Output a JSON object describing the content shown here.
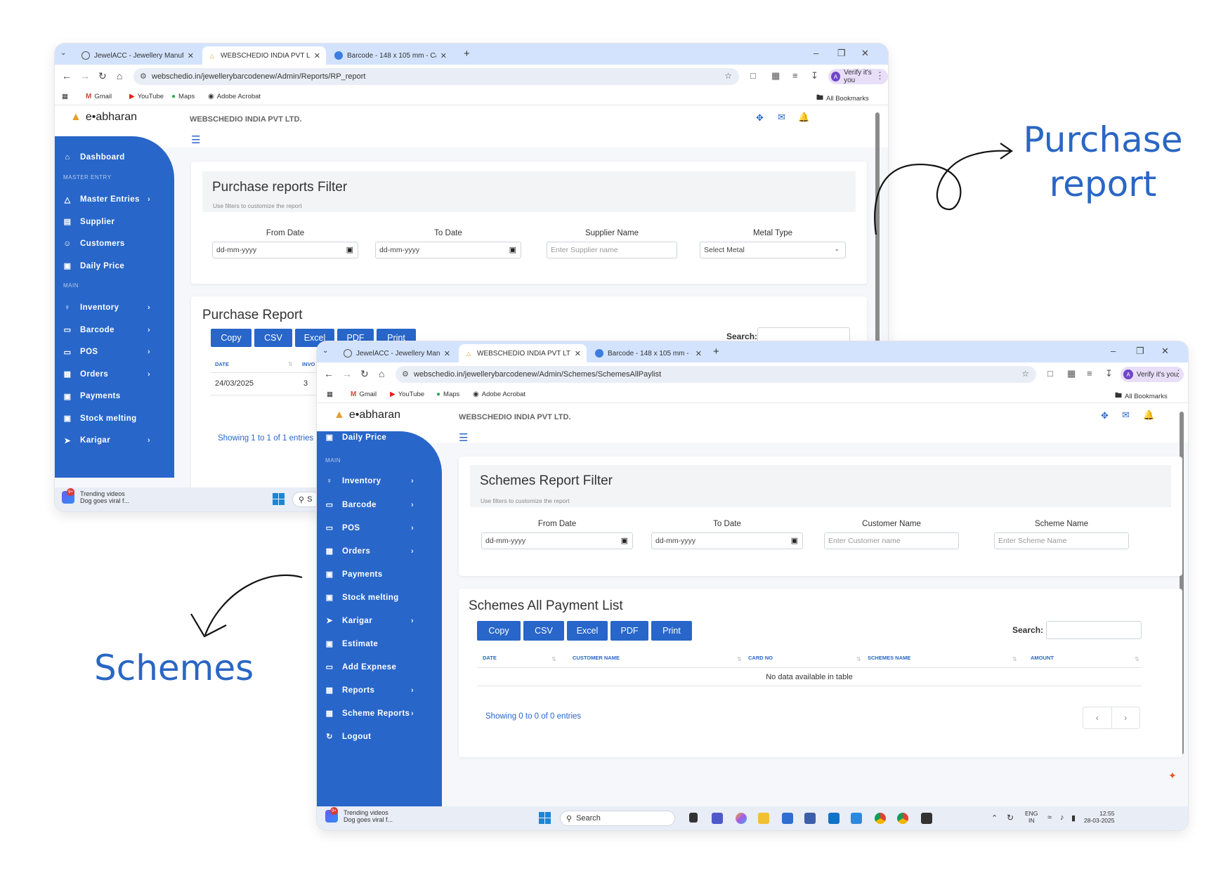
{
  "browser": {
    "tabs": [
      "JewelACC - Jewellery Manufactu...",
      "WEBSCHEDIO INDIA PVT LTD.",
      "Barcode - 148 x 105 mm - Canv..."
    ],
    "verify_label": "Verify it's you",
    "bookmarks": [
      "Gmail",
      "YouTube",
      "Maps",
      "Adobe Acrobat"
    ],
    "all_bookmarks": "All Bookmarks"
  },
  "colors": {
    "primary": "#2866c9",
    "tabbar": "#d3e3fd",
    "annotation": "#2a66c4"
  },
  "app": {
    "logo": "e•abharan",
    "company": "WEBSCHEDIO INDIA PVT LTD."
  },
  "purchase": {
    "url": "webschedio.in/jewellerybarcodenew/Admin/Reports/RP_report",
    "sidebar": {
      "items": [
        {
          "label": "Dashboard",
          "icon": "home-icon"
        },
        {
          "section": "MASTER ENTRY"
        },
        {
          "label": "Master Entries",
          "icon": "compass-icon",
          "chevron": true
        },
        {
          "label": "Supplier",
          "icon": "id-card-icon"
        },
        {
          "label": "Customers",
          "icon": "smile-icon"
        },
        {
          "label": "Daily Price",
          "icon": "money-icon"
        },
        {
          "section": "MAIN"
        },
        {
          "label": "Inventory",
          "icon": "bulb-icon",
          "chevron": true
        },
        {
          "label": "Barcode",
          "icon": "barcode-icon",
          "chevron": true
        },
        {
          "label": "POS",
          "icon": "monitor-icon",
          "chevron": true
        },
        {
          "label": "Orders",
          "icon": "box-icon",
          "chevron": true
        },
        {
          "label": "Payments",
          "icon": "money-icon"
        },
        {
          "label": "Stock melting",
          "icon": "money-icon"
        },
        {
          "label": "Karigar",
          "icon": "hammer-icon",
          "chevron": true
        }
      ]
    },
    "filter": {
      "title": "Purchase reports Filter",
      "subtitle": "Use filters to customize the report",
      "from_label": "From Date",
      "from_value": "dd-mm-yyyy",
      "to_label": "To Date",
      "to_value": "dd-mm-yyyy",
      "supplier_label": "Supplier Name",
      "supplier_placeholder": "Enter Supplier name",
      "metal_label": "Metal Type",
      "metal_value": "Select Metal"
    },
    "list": {
      "title": "Purchase Report",
      "buttons": [
        "Copy",
        "CSV",
        "Excel",
        "PDF",
        "Print"
      ],
      "search_label": "Search:",
      "columns": [
        "DATE",
        "INVO"
      ],
      "rows": [
        [
          "24/03/2025",
          "3"
        ]
      ],
      "info": "Showing 1 to 1 of 1 entries"
    },
    "taskbar": {
      "trending_title": "Trending videos",
      "trending_sub": "Dog goes viral f...",
      "badge": "9+",
      "search": "S"
    }
  },
  "schemes": {
    "url": "webschedio.in/jewellerybarcodenew/Admin/Schemes/SchemesAllPaylist",
    "sidebar": {
      "items": [
        {
          "label": "Daily Price",
          "icon": "money-icon"
        },
        {
          "section": "MAIN"
        },
        {
          "label": "Inventory",
          "icon": "bulb-icon",
          "chevron": true
        },
        {
          "label": "Barcode",
          "icon": "barcode-icon",
          "chevron": true
        },
        {
          "label": "POS",
          "icon": "monitor-icon",
          "chevron": true
        },
        {
          "label": "Orders",
          "icon": "box-icon",
          "chevron": true
        },
        {
          "label": "Payments",
          "icon": "money-icon"
        },
        {
          "label": "Stock melting",
          "icon": "money-icon"
        },
        {
          "label": "Karigar",
          "icon": "hammer-icon",
          "chevron": true
        },
        {
          "label": "Estimate",
          "icon": "money-icon"
        },
        {
          "label": "Add Expnese",
          "icon": "barcode-icon"
        },
        {
          "label": "Reports",
          "icon": "box-icon",
          "chevron": true
        },
        {
          "label": "Scheme Reports",
          "icon": "box-icon",
          "chevron": true
        },
        {
          "label": "Logout",
          "icon": "logout-icon"
        }
      ]
    },
    "filter": {
      "title": "Schemes Report Filter",
      "subtitle": "Use filters to customize the report",
      "from_label": "From Date",
      "from_value": "dd-mm-yyyy",
      "to_label": "To Date",
      "to_value": "dd-mm-yyyy",
      "customer_label": "Customer Name",
      "customer_placeholder": "Enter Customer name",
      "scheme_label": "Scheme Name",
      "scheme_placeholder": "Enter Scheme Name"
    },
    "list": {
      "title": "Schemes All Payment List",
      "buttons": [
        "Copy",
        "CSV",
        "Excel",
        "PDF",
        "Print"
      ],
      "search_label": "Search:",
      "columns": [
        "DATE",
        "CUSTOMER NAME",
        "CARD NO",
        "SCHEMES NAME",
        "AMOUNT"
      ],
      "empty": "No data available in table",
      "info": "Showing 0 to 0 of 0 entries",
      "prev": "‹",
      "next": "›"
    },
    "taskbar": {
      "trending_title": "Trending videos",
      "trending_sub": "Dog goes viral f...",
      "badge": "9+",
      "search": "Search",
      "lang": "ENG",
      "region": "IN",
      "time": "12:55",
      "date": "28-03-2025"
    }
  },
  "annotations": {
    "purchase": "Purchase report",
    "schemes": "Schemes"
  }
}
